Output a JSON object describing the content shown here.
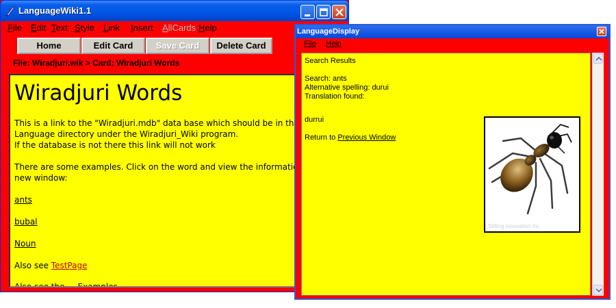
{
  "main_window": {
    "title": "LanguageWiki1.1",
    "menu": [
      "File",
      "Edit",
      "Text",
      "Style",
      "Link",
      "Insert",
      "AllCards",
      "Help"
    ],
    "buttons": {
      "home": "Home",
      "edit_card": "Edit Card",
      "save_card": "Save Card",
      "delete_card": "Delete Card"
    },
    "breadcrumb": "File: Wiradjuri.wik > Card: Wiradjuri Words",
    "content": {
      "heading": "Wiradjuri Words",
      "para1_line1": "This is a link to the \"Wiradjuri.mdb\" data base which should be in the",
      "para1_line2": "Language directory under the Wiradjuri_Wiki program.",
      "para1_line3": "If the database is not there this link will not work",
      "para2_line1": "There are some examples. Click on the word and view the information",
      "para2_line2": "new window:",
      "link_ants": "ants",
      "link_bubal": "bubal",
      "link_noun": "Noun",
      "also_see_prefix": "Also see ",
      "link_testpage": "TestPage",
      "cut_line": "Also see the ... Examples"
    }
  },
  "display_window": {
    "title": "LanguageDisplay",
    "menu": [
      "File",
      "Help"
    ],
    "content": {
      "heading": "Search Results",
      "search": "Search: ants",
      "alt_spelling": "Alternative spelling:  durui",
      "translation_found": "Translation found:",
      "translation": "durrui",
      "return_prefix": "Return to ",
      "return_link": "Previous Window",
      "image_watermark": "Stilling Innovation Inc"
    }
  },
  "colors": {
    "window_bg": "#ff0000",
    "content_bg": "#ffff00",
    "titlebar_blue": "#0055e5",
    "link_red": "#c00000"
  },
  "icons": {
    "app": "feather-pen-icon",
    "minimize": "minimize-icon",
    "maximize": "maximize-icon",
    "close": "close-icon",
    "image": "ant-icon"
  }
}
